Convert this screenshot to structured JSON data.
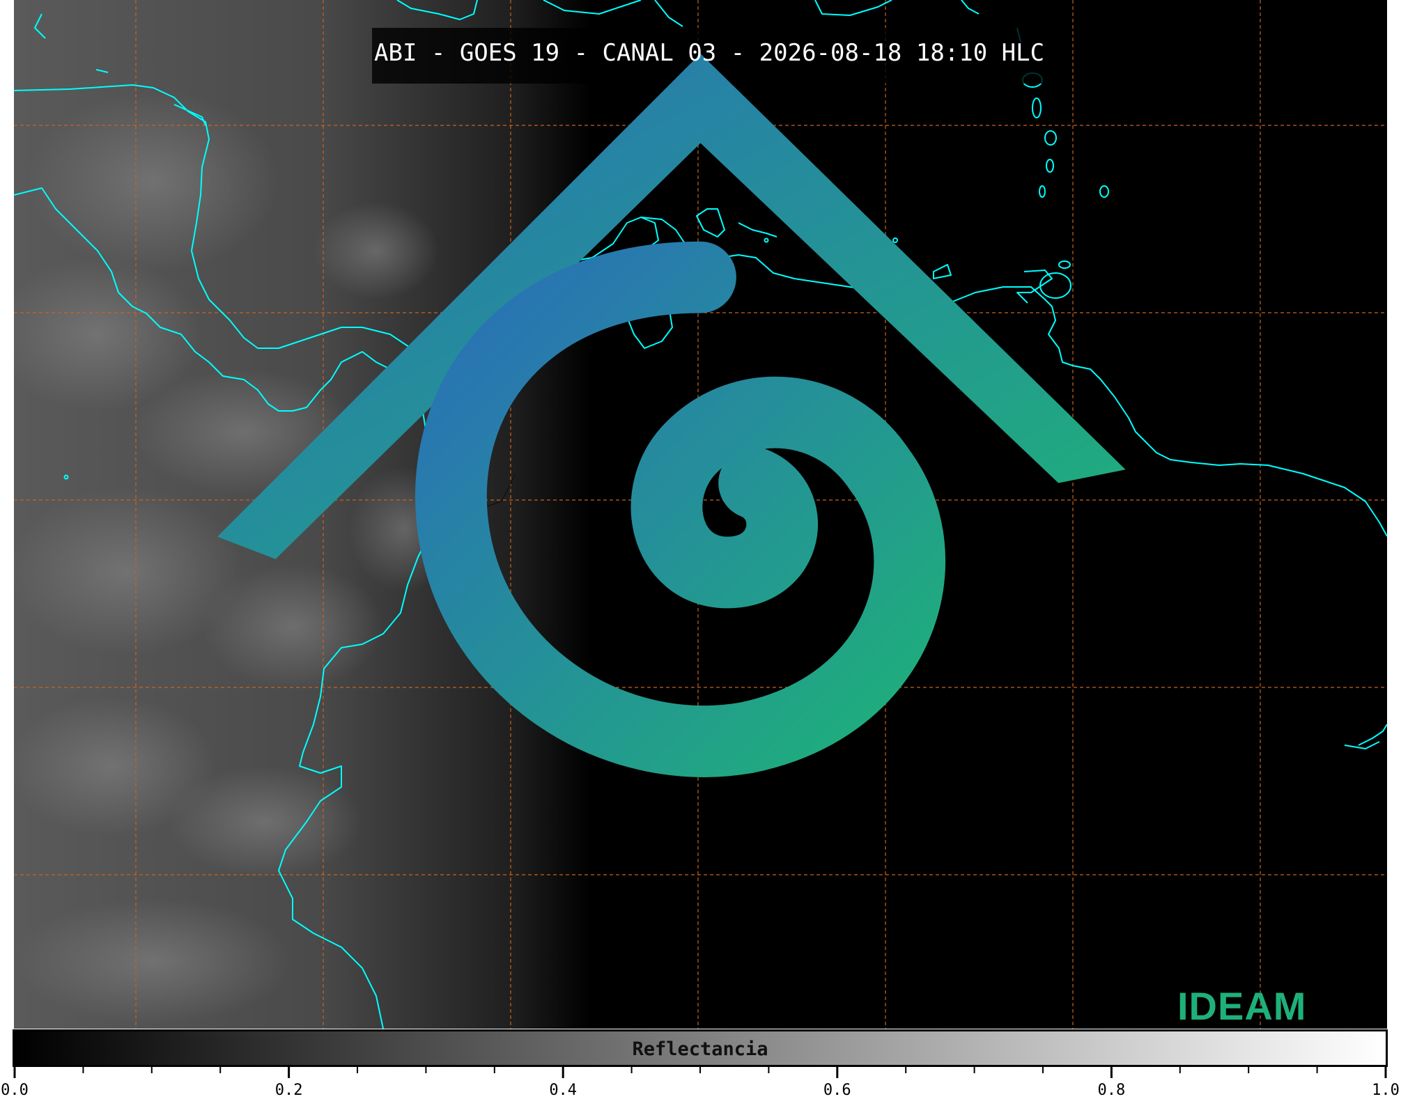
{
  "title": "ABI - GOES 19 - CANAL 03 - 2026-08-18 18:10 HLC",
  "colorbar": {
    "label": "Reflectancia",
    "min": 0.0,
    "max": 1.0,
    "tick_labels": [
      "0.0",
      "0.2",
      "0.4",
      "0.6",
      "0.8",
      "1.0"
    ],
    "colors": [
      "#000000",
      "#ffffff"
    ]
  },
  "logo": {
    "text": "IDEAM"
  },
  "colors": {
    "coastline": "#00ffff",
    "gridlines": "#c8641e",
    "borders": "#101010",
    "logo": "#1fb07a"
  }
}
